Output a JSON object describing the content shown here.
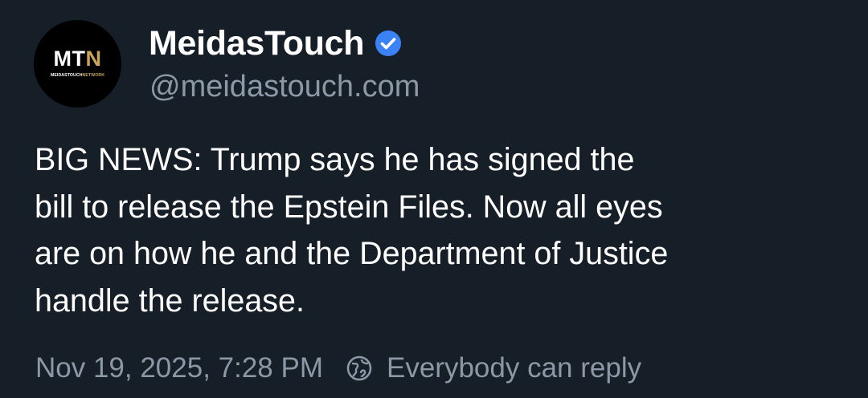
{
  "author": {
    "avatar_logo_white": "MT",
    "avatar_logo_gold": "N",
    "avatar_sub_white": "MEIDASTOUCH",
    "avatar_sub_gold": "NETWORK",
    "display_name": "MeidasTouch",
    "verified": true,
    "handle": "@meidastouch.com"
  },
  "post": {
    "lines": [
      "BIG NEWS: Trump says he has signed the",
      "bill to release the Epstein Files. Now all eyes",
      "are on how he and the Department of Justice",
      "handle the release."
    ],
    "timestamp": "Nov 19, 2025, 7:28 PM",
    "reply_setting": "Everybody can reply"
  },
  "colors": {
    "background": "#161e27",
    "verified_badge": "#3b82f6",
    "muted_text": "#8b98a5",
    "logo_gold": "#c9a45b"
  },
  "icons": {
    "verified": "verified-badge-icon",
    "reply_setting": "globe-reply-icon"
  }
}
